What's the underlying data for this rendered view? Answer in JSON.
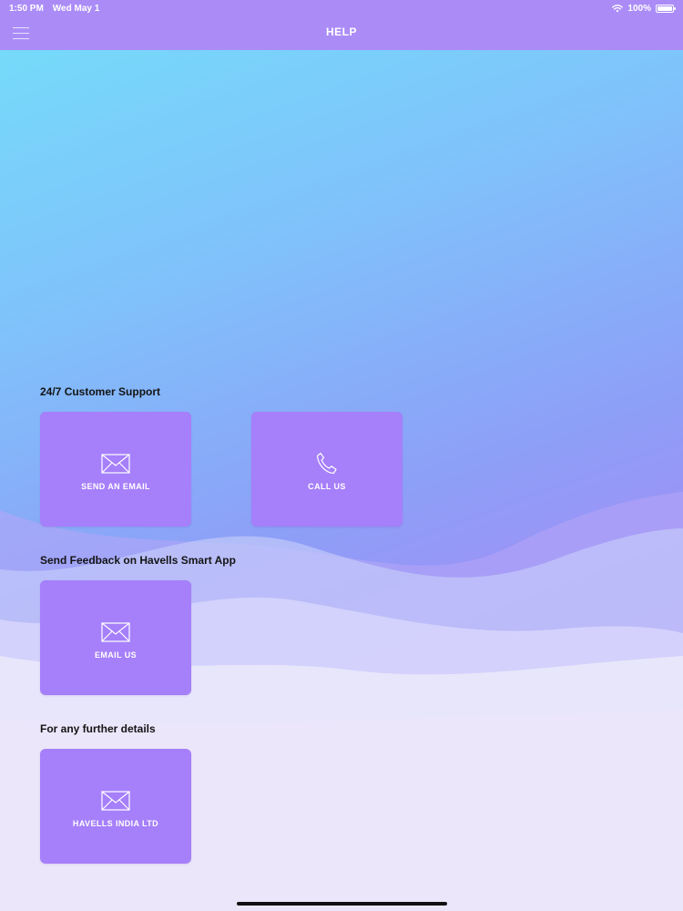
{
  "status_bar": {
    "time": "1:50 PM",
    "date": "Wed May 1",
    "battery": "100%"
  },
  "header": {
    "title": "HELP",
    "menu_icon": "hamburger-menu-icon"
  },
  "sections": {
    "support": {
      "title": "24/7 Customer Support",
      "email_label": "SEND AN EMAIL",
      "email_icon": "envelope-icon",
      "call_label": "CALL US",
      "call_icon": "phone-icon"
    },
    "feedback": {
      "title": "Send Feedback on Havells Smart App",
      "email_label": "EMAIL US",
      "email_icon": "envelope-icon"
    },
    "details": {
      "title": "For any further details",
      "company_label": "HAVELLS INDIA LTD",
      "company_icon": "envelope-icon"
    }
  },
  "colors": {
    "nav_bar": "#ab8cf7",
    "card": "#a67ffa",
    "gradient_top": "#74def9",
    "gradient_bottom": "#ae8af6"
  }
}
